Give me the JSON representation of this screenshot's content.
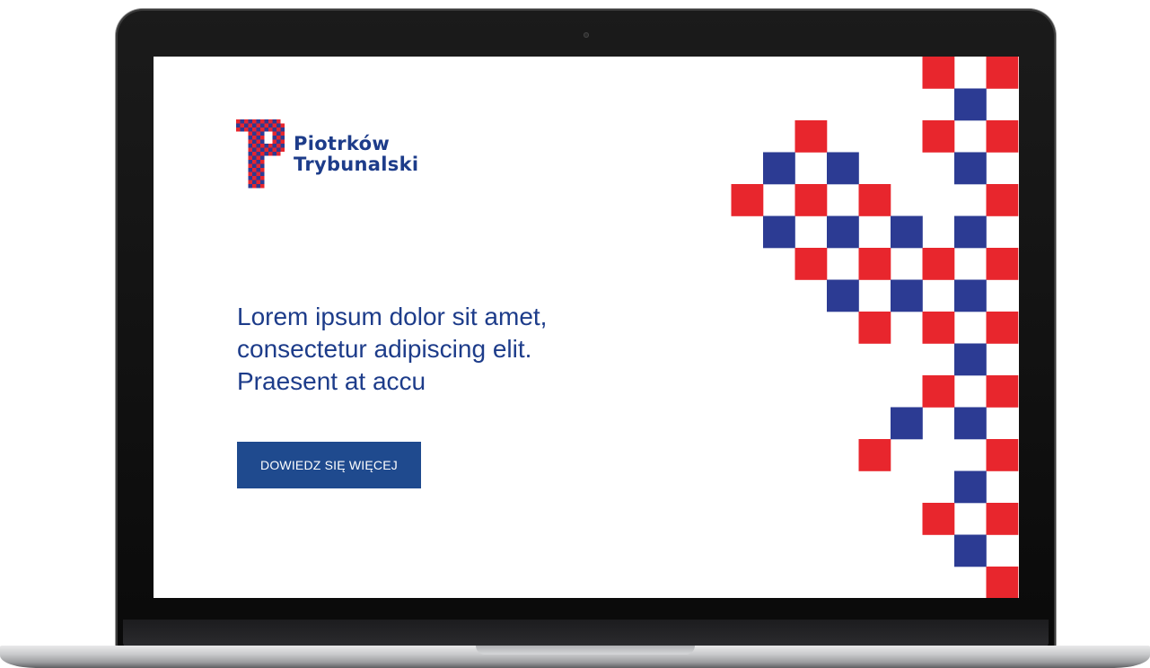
{
  "brand": {
    "line1": "Piotrków",
    "line2": "Trybunalski",
    "colors": {
      "blue": "#2c3b93",
      "red": "#e8262d",
      "text": "#1d3c8a",
      "button": "#1f4a8e"
    }
  },
  "hero": {
    "headline_lines": [
      "Lorem ipsum dolor sit amet,",
      "consectetur adipiscing elit.",
      "Praesent at accu"
    ],
    "cta_label": "DOWIEDZ SIĘ WIĘCEJ"
  },
  "icons": {
    "logo": "checkered-p-logo-icon",
    "pattern": "checkered-decoration-icon",
    "camera": "webcam-icon"
  }
}
